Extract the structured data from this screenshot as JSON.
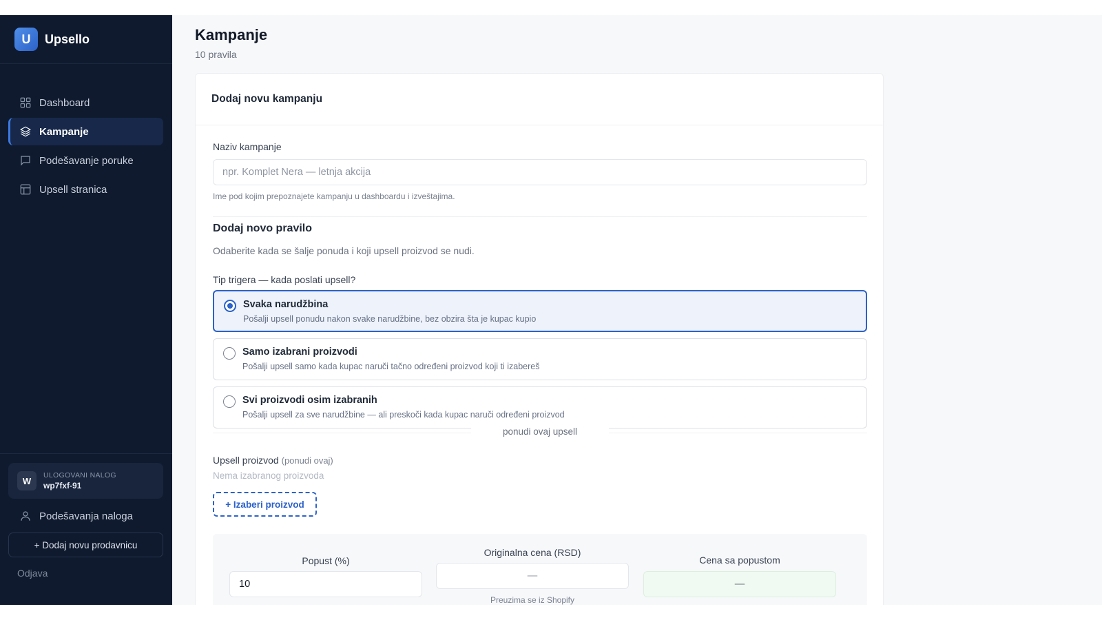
{
  "app": {
    "logo_letter": "U",
    "name": "Upsello"
  },
  "sidebar": {
    "items": [
      {
        "label": "Dashboard",
        "icon": "grid-icon",
        "active": false
      },
      {
        "label": "Kampanje",
        "icon": "layers-icon",
        "active": true
      },
      {
        "label": "Podešavanje poruke",
        "icon": "message-icon",
        "active": false
      },
      {
        "label": "Upsell stranica",
        "icon": "layout-icon",
        "active": false
      }
    ],
    "account": {
      "avatar_letter": "W",
      "label": "ULOGOVANI NALOG",
      "id": "wp7fxf-91"
    },
    "settings_label": "Podešavanja naloga",
    "add_store_label": "+ Dodaj novu prodavnicu",
    "logout_label": "Odjava"
  },
  "page": {
    "title": "Kampanje",
    "subtitle": "10 pravila"
  },
  "form": {
    "card_title": "Dodaj novu kampanju",
    "name_label": "Naziv kampanje",
    "name_placeholder": "npr. Komplet Nera — letnja akcija",
    "name_hint": "Ime pod kojim prepoznajete kampanju u dashboardu i izveštajima.",
    "rule_title": "Dodaj novo pravilo",
    "rule_subtitle": "Odaberite kada se šalje ponuda i koji upsell proizvod se nudi.",
    "trigger_label": "Tip trigera — kada poslati upsell?",
    "trigger_options": [
      {
        "title": "Svaka narudžbina",
        "desc": "Pošalji upsell ponudu nakon svake narudžbine, bez obzira šta je kupac kupio",
        "selected": true
      },
      {
        "title": "Samo izabrani proizvodi",
        "desc": "Pošalji upsell samo kada kupac naruči tačno određeni proizvod koji ti izabereš",
        "selected": false
      },
      {
        "title": "Svi proizvodi osim izabranih",
        "desc": "Pošalji upsell za sve narudžbine — ali preskoči kada kupac naruči određeni proizvod",
        "selected": false
      }
    ],
    "separator_text": "ponudi ovaj upsell",
    "upsell_label": "Upsell proizvod",
    "upsell_label_suffix": "(ponudi ovaj)",
    "no_product": "Nema izabranog proizvoda",
    "pick_button": "+ Izaberi proizvod",
    "discount_label": "Popust (%)",
    "discount_value": "10",
    "original_price_label": "Originalna cena (RSD)",
    "original_price_value": "—",
    "original_price_note": "Preuzima se iz Shopify",
    "discounted_price_label": "Cena sa popustom",
    "discounted_price_value": "—"
  },
  "colors": {
    "sidebar_bg": "#0f1a2e",
    "accent": "#2c62c9",
    "main_bg": "#f7f8fa"
  }
}
